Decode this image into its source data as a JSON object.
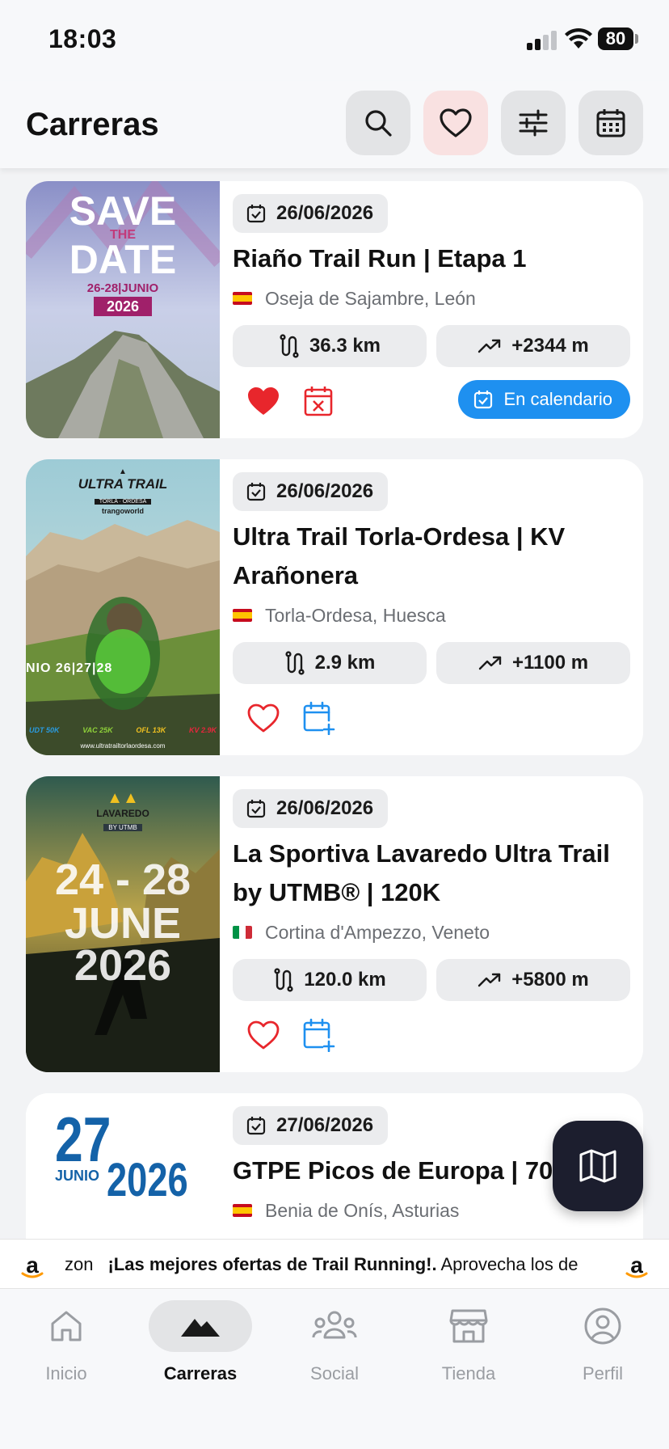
{
  "status_bar": {
    "time": "18:03",
    "battery": "80"
  },
  "header": {
    "title": "Carreras"
  },
  "races": [
    {
      "date": "26/06/2026",
      "title": "Riaño Trail Run | Etapa 1",
      "country": "es",
      "location": "Oseja de Sajambre, León",
      "distance": "36.3 km",
      "elevation": "+2344 m",
      "favorite": true,
      "in_calendar": true,
      "calendar_badge": "En calendario",
      "poster": {
        "line1": "SAVE",
        "line2": "THE",
        "line3": "DATE",
        "dates": "26-28|JUNIO",
        "year": "2026"
      }
    },
    {
      "date": "26/06/2026",
      "title": "Ultra Trail Torla-Ordesa | KV Arañonera",
      "country": "es",
      "location": "Torla-Ordesa, Huesca",
      "distance": "2.9 km",
      "elevation": "+1100 m",
      "favorite": false,
      "in_calendar": false,
      "poster": {
        "brand": "ULTRA TRAIL",
        "sub": "TORLA · ORDESA",
        "sponsor": "trangoworld",
        "dates": "NIO 26|27|28",
        "footer": "www.ultratrailtorlaordesa.com",
        "tags": [
          "UDT 50K",
          "VAC 25K",
          "OFL 13K",
          "KV 2.9K"
        ]
      }
    },
    {
      "date": "26/06/2026",
      "title": "La Sportiva Lavaredo Ultra Trail by UTMB® | 120K",
      "country": "it",
      "location": "Cortina d'Ampezzo, Veneto",
      "distance": "120.0 km",
      "elevation": "+5800 m",
      "favorite": false,
      "in_calendar": false,
      "poster": {
        "brand": "LAVAREDO",
        "sub": "BY UTMB",
        "line1": "24 - 28",
        "line2": "JUNE",
        "line3": "2026"
      }
    },
    {
      "date": "27/06/2026",
      "title": "GTPE Picos de Europa | 70K",
      "country": "es",
      "location": "Benia de Onís, Asturias",
      "poster": {
        "day": "27",
        "month": "JUNIO",
        "year": "2026"
      }
    }
  ],
  "ad": {
    "left_logo": "a",
    "prefix": "zon",
    "headline": "¡Las mejores ofertas de Trail Running!.",
    "text": " Aprovecha los de",
    "right_logo": "a"
  },
  "tabs": [
    {
      "label": "Inicio",
      "icon": "home-icon",
      "active": false
    },
    {
      "label": "Carreras",
      "icon": "mountain-icon",
      "active": true
    },
    {
      "label": "Social",
      "icon": "people-icon",
      "active": false
    },
    {
      "label": "Tienda",
      "icon": "store-icon",
      "active": false
    },
    {
      "label": "Perfil",
      "icon": "profile-icon",
      "active": false
    }
  ],
  "colors": {
    "accent_blue": "#1e90f0",
    "favorite_red": "#e8262c",
    "fab_dark": "#1c1e2e"
  }
}
